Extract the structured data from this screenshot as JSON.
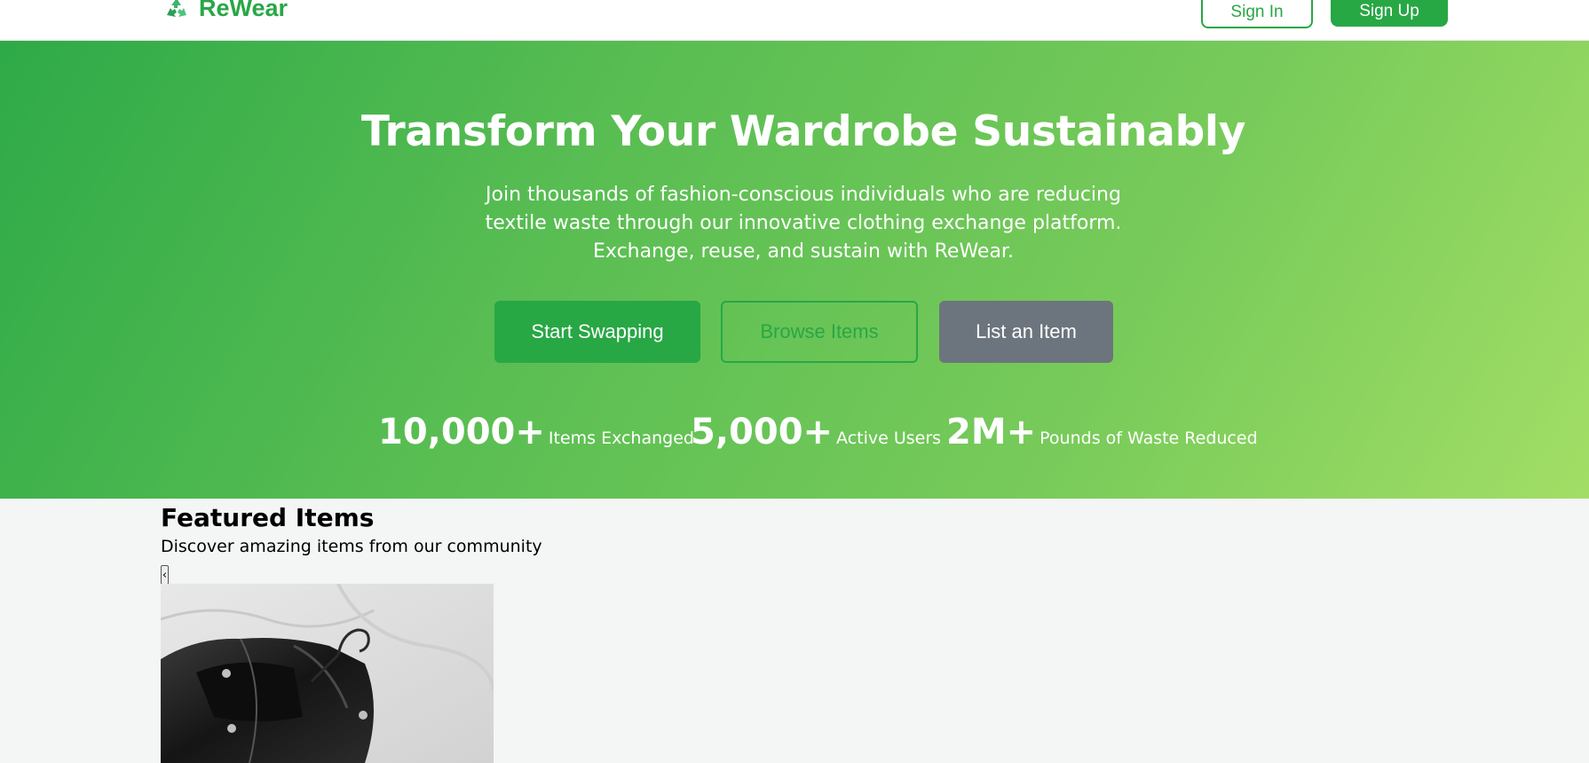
{
  "header": {
    "logo_icon": "recycle-icon",
    "logo_text": "ReWear",
    "signin_label": "Sign In",
    "signup_label": "Sign Up"
  },
  "hero": {
    "title": "Transform Your Wardrobe Sustainably",
    "subtitle": "Join thousands of fashion-conscious individuals who are reducing textile waste through our innovative clothing exchange platform. Exchange, reuse, and sustain with ReWear.",
    "buttons": {
      "start": "Start Swapping",
      "browse": "Browse Items",
      "list": "List an Item"
    },
    "stats": [
      {
        "value": "10,000+",
        "label": "Items Exchanged"
      },
      {
        "value": "5,000+",
        "label": "Active Users"
      },
      {
        "value": "2M+",
        "label": "Pounds of Waste Reduced"
      }
    ]
  },
  "featured": {
    "title": "Featured Items",
    "subtitle": "Discover amazing items from our community",
    "prev_label": "‹",
    "items": [
      {
        "image": "black-leather-jacket-photo"
      }
    ]
  },
  "colors": {
    "brand": "#28a745",
    "secondary": "#6c757d",
    "gradient_start": "#2eaa48",
    "gradient_end": "#a2de66"
  }
}
